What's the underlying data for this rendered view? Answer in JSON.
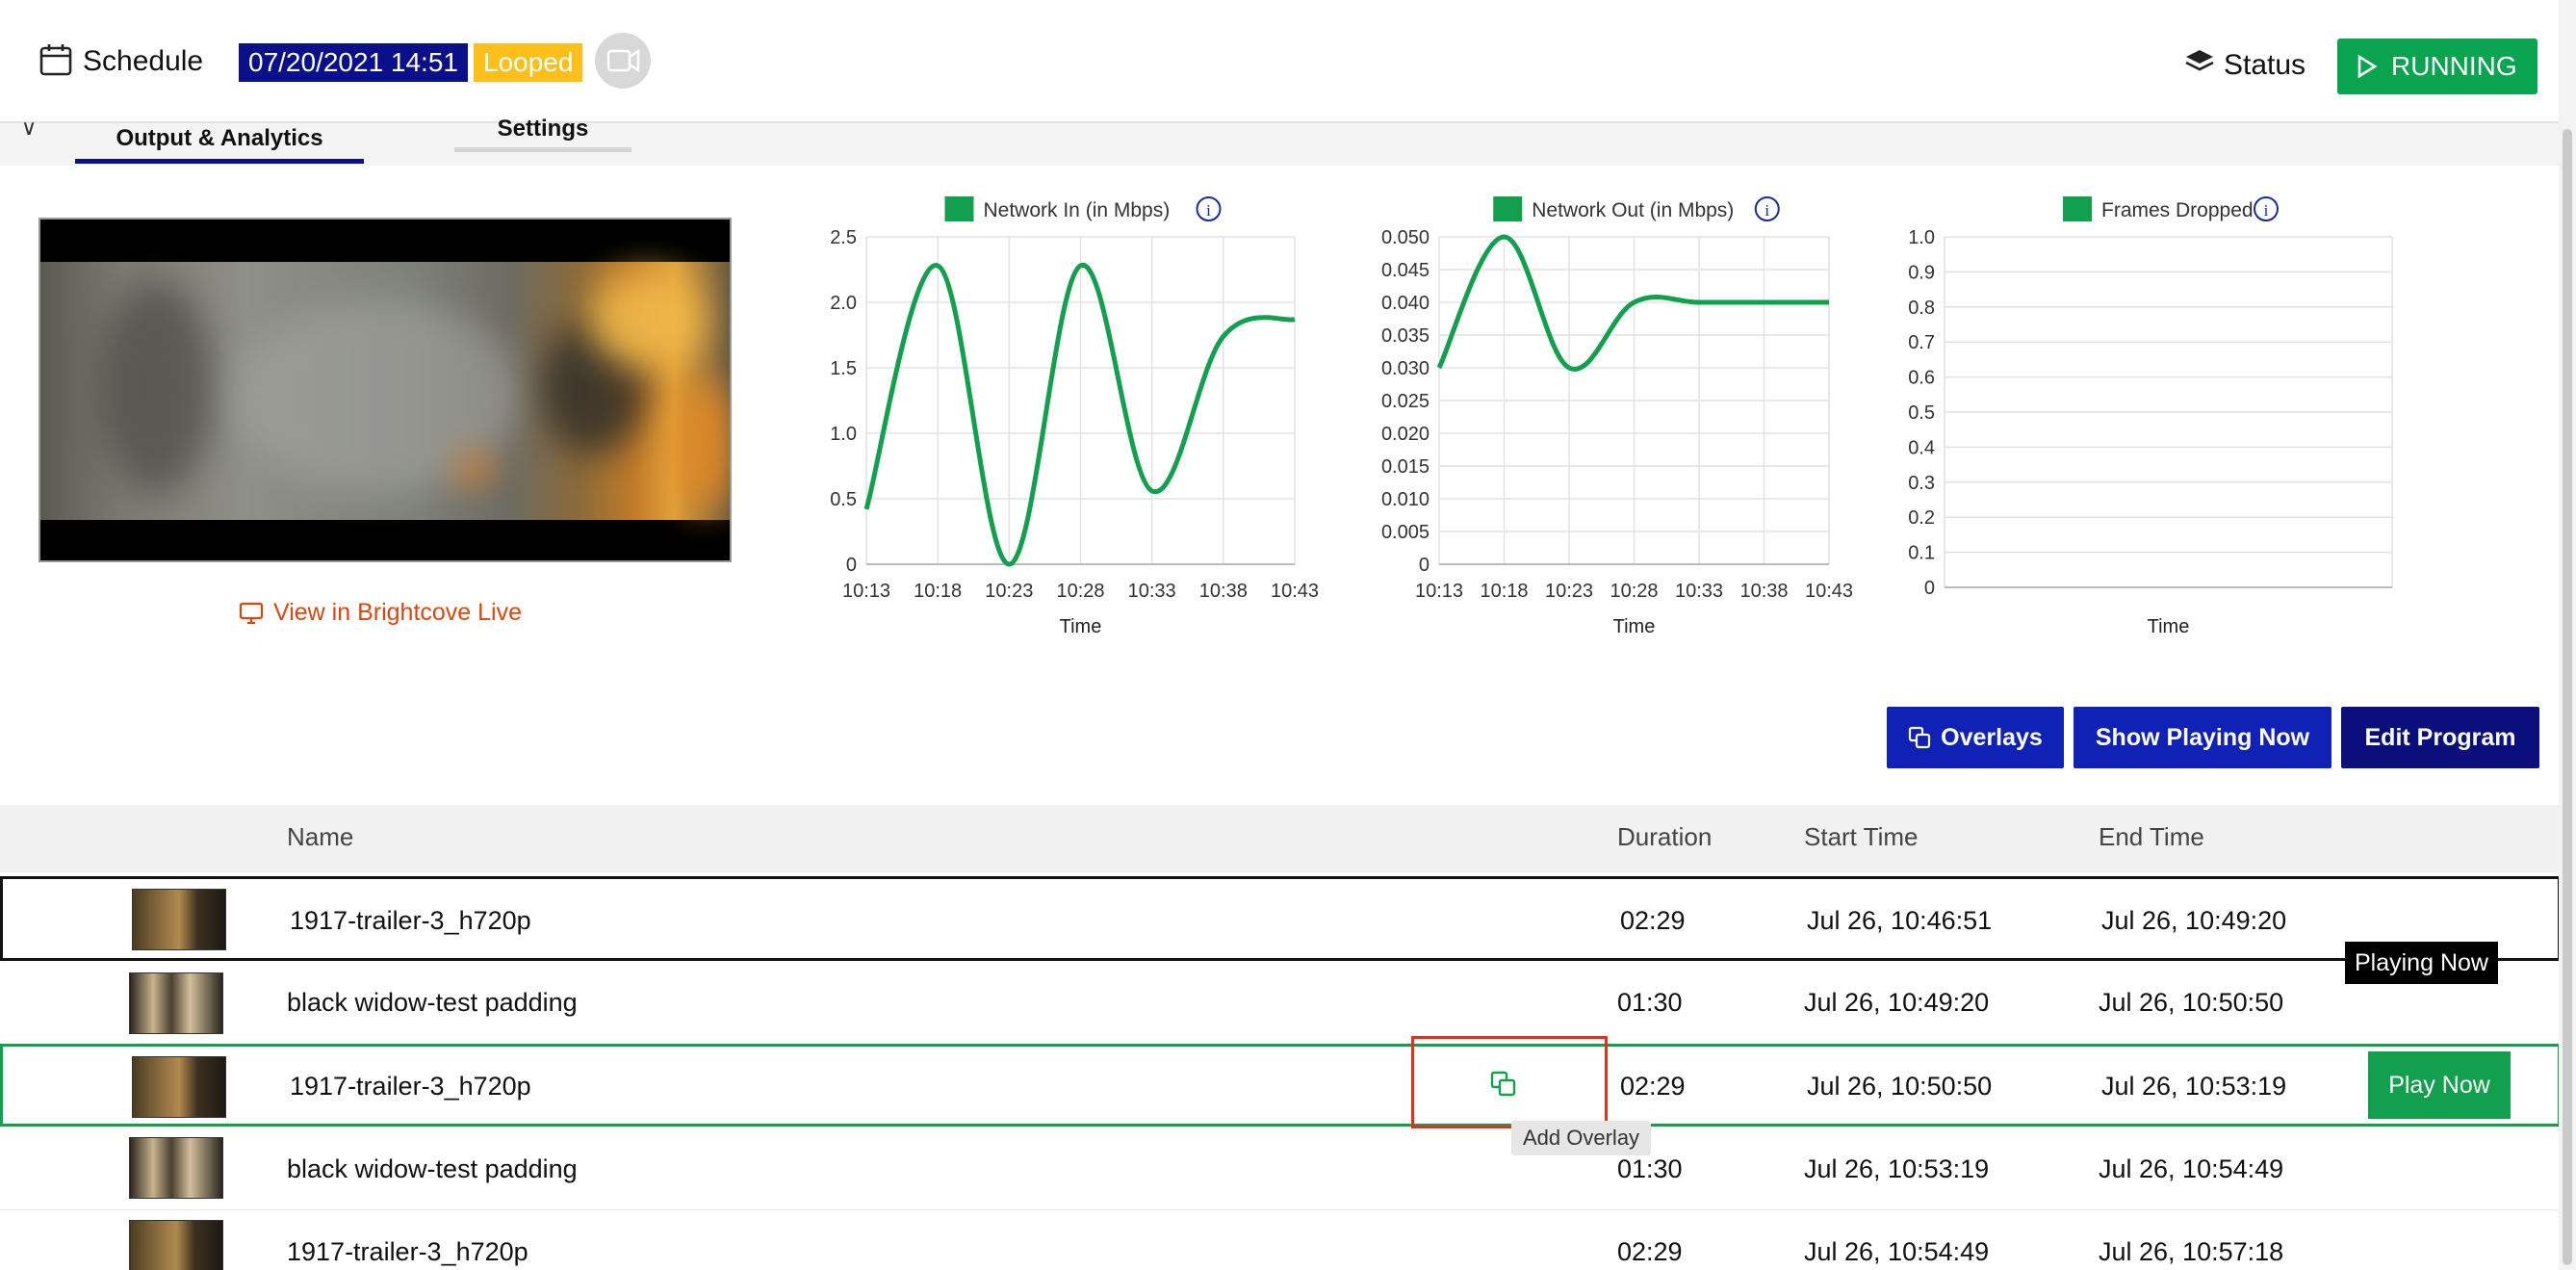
{
  "header": {
    "schedule_label": "Schedule",
    "date_badge": "07/20/2021 14:51",
    "looped_badge": "Looped",
    "status_label": "Status",
    "running_label": "RUNNING"
  },
  "tabs": [
    {
      "label": "Output & Analytics",
      "active": true
    },
    {
      "label": "Settings",
      "active": false
    }
  ],
  "preview": {
    "view_link": "View in Brightcove Live"
  },
  "chart_data": [
    {
      "type": "line",
      "legend": "Network In (in Mbps)",
      "xlabel": "Time",
      "x": [
        "10:13",
        "10:18",
        "10:23",
        "10:28",
        "10:33",
        "10:38",
        "10:43"
      ],
      "y_ticks": [
        "0",
        "0.5",
        "1.0",
        "1.5",
        "2.0",
        "2.5"
      ],
      "ylim": [
        0,
        2.5
      ],
      "color": "#12a04e",
      "series": [
        {
          "values": [
            0.42,
            2.28,
            0.0,
            2.28,
            0.56,
            1.74,
            1.87
          ]
        }
      ]
    },
    {
      "type": "line",
      "legend": "Network Out (in Mbps)",
      "xlabel": "Time",
      "x": [
        "10:13",
        "10:18",
        "10:23",
        "10:28",
        "10:33",
        "10:38",
        "10:43"
      ],
      "y_ticks": [
        "0",
        "0.005",
        "0.010",
        "0.015",
        "0.020",
        "0.025",
        "0.030",
        "0.035",
        "0.040",
        "0.045",
        "0.050"
      ],
      "ylim": [
        0,
        0.05
      ],
      "color": "#12a04e",
      "series": [
        {
          "values": [
            0.03,
            0.05,
            0.03,
            0.04,
            0.04,
            0.04,
            0.04
          ]
        }
      ]
    },
    {
      "type": "line",
      "legend": "Frames Dropped",
      "xlabel": "Time",
      "x": [],
      "y_ticks": [
        "0",
        "0.1",
        "0.2",
        "0.3",
        "0.4",
        "0.5",
        "0.6",
        "0.7",
        "0.8",
        "0.9",
        "1.0"
      ],
      "ylim": [
        0,
        1.0
      ],
      "color": "#12a04e",
      "series": []
    }
  ],
  "actions": {
    "overlays": "Overlays",
    "show_playing_now": "Show Playing Now",
    "edit_program": "Edit Program"
  },
  "table": {
    "columns": [
      "Name",
      "Duration",
      "Start Time",
      "End Time"
    ],
    "rows": [
      {
        "name": "1917-trailer-3_h720p",
        "duration": "02:29",
        "start": "Jul 26, 10:46:51",
        "end": "Jul 26, 10:49:20",
        "thumb": "fire"
      },
      {
        "name": "black widow-test padding",
        "duration": "01:30",
        "start": "Jul 26, 10:49:20",
        "end": "Jul 26, 10:50:50",
        "thumb": "room"
      },
      {
        "name": "1917-trailer-3_h720p",
        "duration": "02:29",
        "start": "Jul 26, 10:50:50",
        "end": "Jul 26, 10:53:19",
        "thumb": "fire"
      },
      {
        "name": "black widow-test padding",
        "duration": "01:30",
        "start": "Jul 26, 10:53:19",
        "end": "Jul 26, 10:54:49",
        "thumb": "room"
      },
      {
        "name": "1917-trailer-3_h720p",
        "duration": "02:29",
        "start": "Jul 26, 10:54:49",
        "end": "Jul 26, 10:57:18",
        "thumb": "fire"
      }
    ],
    "playing_now_label": "Playing Now",
    "play_now_label": "Play Now",
    "tooltip": "Add Overlay"
  }
}
